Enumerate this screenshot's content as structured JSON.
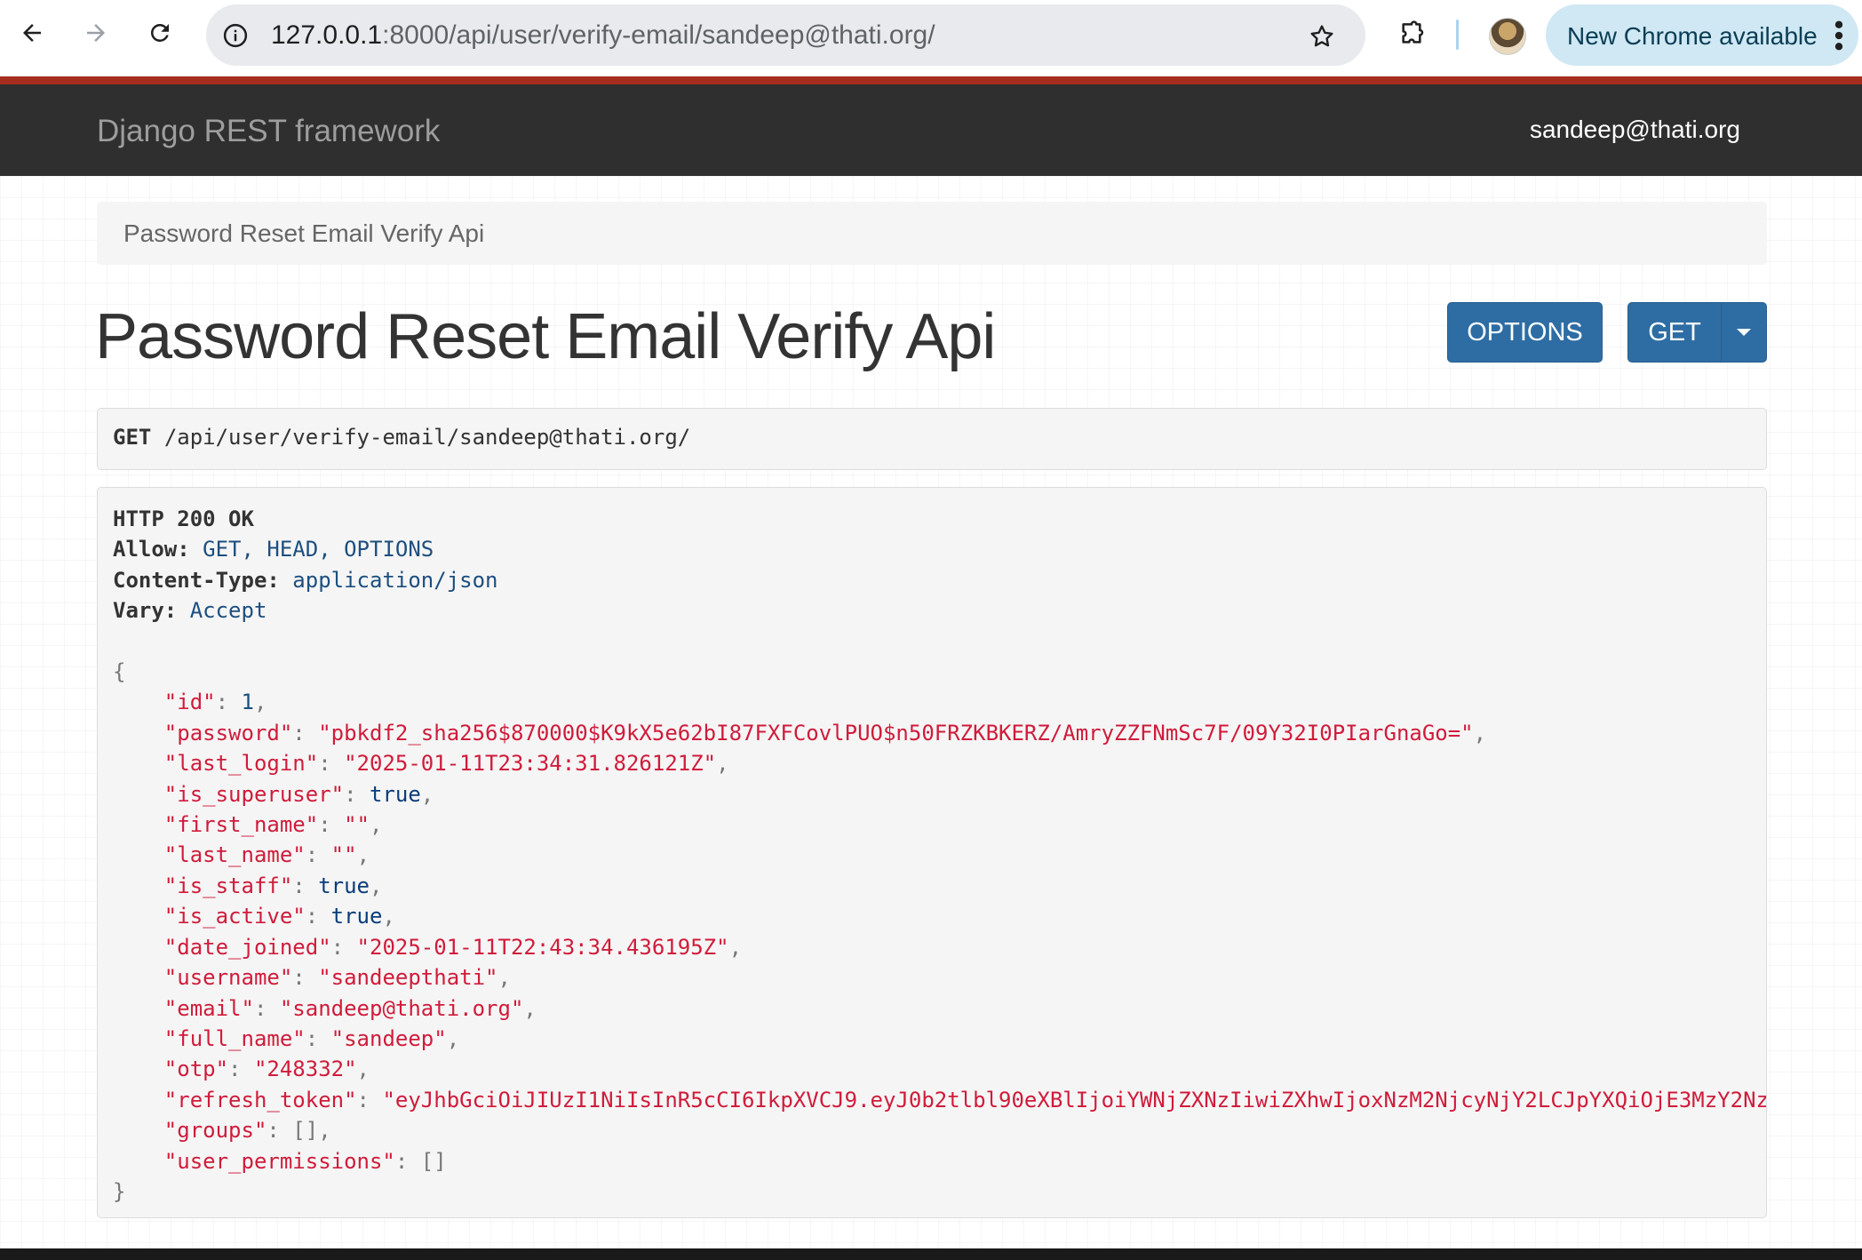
{
  "browser": {
    "url_host": "127.0.0.1",
    "url_rest": ":8000/api/user/verify-email/sandeep@thati.org/",
    "update_label": "New Chrome available"
  },
  "navbar": {
    "brand": "Django REST framework",
    "user": "sandeep@thati.org"
  },
  "breadcrumb": "Password Reset Email Verify Api",
  "title": "Password Reset Email Verify Api",
  "buttons": {
    "options": "OPTIONS",
    "get": "GET"
  },
  "request": {
    "method": "GET",
    "path": "/api/user/verify-email/sandeep@thati.org/"
  },
  "response": {
    "status": "HTTP 200 OK",
    "headers": [
      {
        "key": "Allow:",
        "value": "GET, HEAD, OPTIONS"
      },
      {
        "key": "Content-Type:",
        "value": "application/json"
      },
      {
        "key": "Vary:",
        "value": "Accept"
      }
    ],
    "fields": [
      {
        "key": "\"id\"",
        "value": "1",
        "type": "num",
        "comma": true
      },
      {
        "key": "\"password\"",
        "value": "\"pbkdf2_sha256$870000$K9kX5e62bI87FXFCovlPUO$n50FRZKBKERZ/AmryZZFNmSc7F/09Y32I0PIarGnaGo=\"",
        "type": "str",
        "comma": true
      },
      {
        "key": "\"last_login\"",
        "value": "\"2025-01-11T23:34:31.826121Z\"",
        "type": "str",
        "comma": true
      },
      {
        "key": "\"is_superuser\"",
        "value": "true",
        "type": "lit",
        "comma": true
      },
      {
        "key": "\"first_name\"",
        "value": "\"\"",
        "type": "str",
        "comma": true
      },
      {
        "key": "\"last_name\"",
        "value": "\"\"",
        "type": "str",
        "comma": true
      },
      {
        "key": "\"is_staff\"",
        "value": "true",
        "type": "lit",
        "comma": true
      },
      {
        "key": "\"is_active\"",
        "value": "true",
        "type": "lit",
        "comma": true
      },
      {
        "key": "\"date_joined\"",
        "value": "\"2025-01-11T22:43:34.436195Z\"",
        "type": "str",
        "comma": true
      },
      {
        "key": "\"username\"",
        "value": "\"sandeepthati\"",
        "type": "str",
        "comma": true
      },
      {
        "key": "\"email\"",
        "value": "\"sandeep@thati.org\"",
        "type": "str",
        "comma": true
      },
      {
        "key": "\"full_name\"",
        "value": "\"sandeep\"",
        "type": "str",
        "comma": true
      },
      {
        "key": "\"otp\"",
        "value": "\"248332\"",
        "type": "str",
        "comma": true
      },
      {
        "key": "\"refresh_token\"",
        "value": "\"eyJhbGciOiJIUzI1NiIsInR5cCI6IkpXVCJ9.eyJ0b2tlbl90eXBlIjoiYWNjZXNzIiwiZXhwIjoxNzM2NjcyNjY2LCJpYXQiOjE3MzY2Nz",
        "type": "str",
        "comma": false
      },
      {
        "key": "\"groups\"",
        "value": "[]",
        "type": "pun",
        "comma": true
      },
      {
        "key": "\"user_permissions\"",
        "value": "[]",
        "type": "pun",
        "comma": false
      }
    ]
  }
}
